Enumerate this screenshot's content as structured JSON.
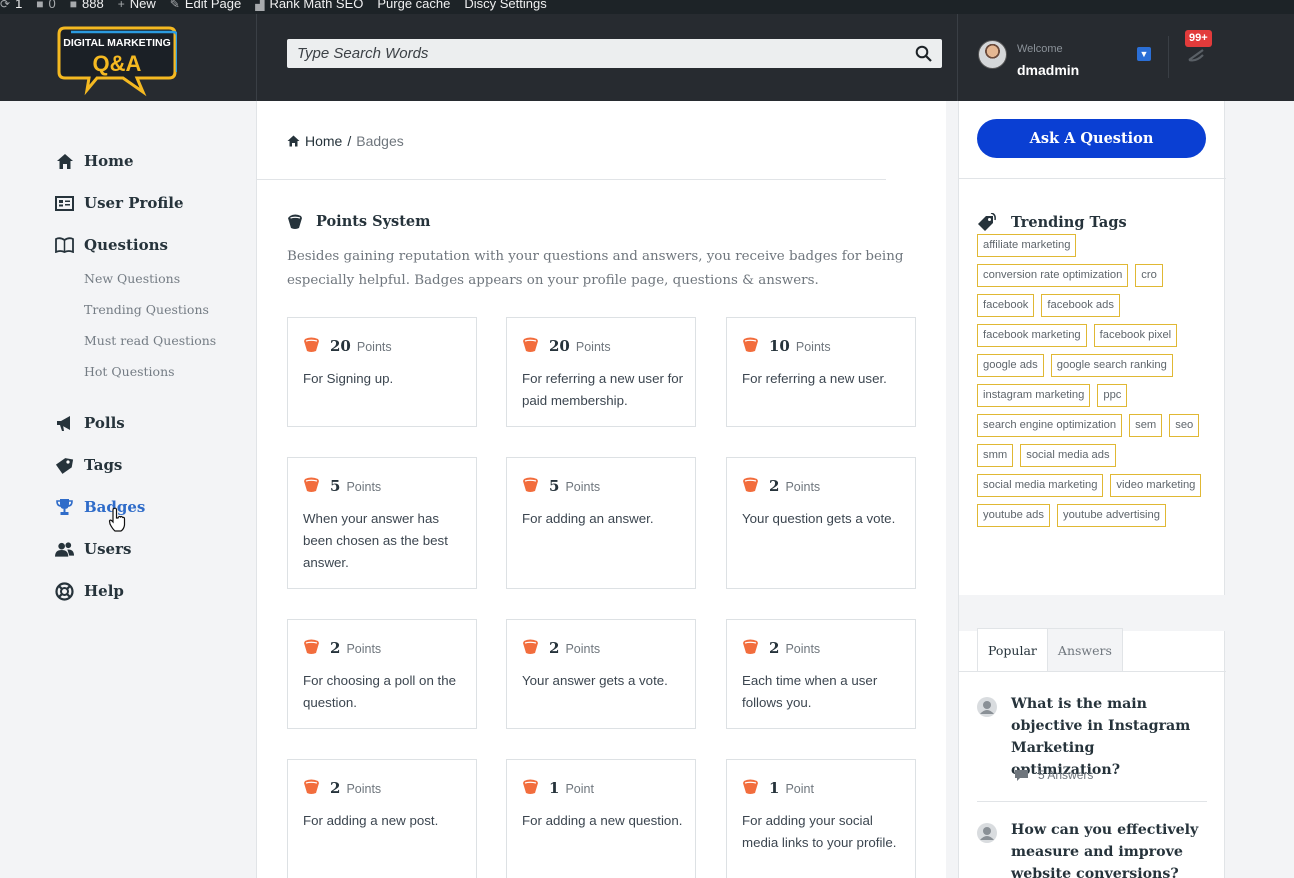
{
  "adminbar": {
    "updates": "1",
    "comments": "0",
    "count": "888",
    "new_label": "New",
    "edit_page": "Edit Page",
    "rank_math": "Rank Math SEO",
    "purge_cache": "Purge cache",
    "discy_settings": "Discy Settings"
  },
  "header": {
    "logo_line1": "DIGITAL MARKETING",
    "logo_line2": "Q&A",
    "search_placeholder": "Type Search Words",
    "welcome": "Welcome",
    "username": "dmadmin",
    "notif_count": "99+"
  },
  "nav": {
    "home": "Home",
    "user_profile": "User Profile",
    "questions": "Questions",
    "sub": [
      "New Questions",
      "Trending Questions",
      "Must read Questions",
      "Hot Questions"
    ],
    "polls": "Polls",
    "tags": "Tags",
    "badges": "Badges",
    "users": "Users",
    "help": "Help"
  },
  "breadcrumb": {
    "home": "Home",
    "sep": "/",
    "current": "Badges"
  },
  "points": {
    "title": "Points System",
    "intro": "Besides gaining reputation with your questions and answers, you receive badges for being especially helpful. Badges appears on your profile page, questions & answers.",
    "cards": [
      {
        "num": "20",
        "unit": "Points",
        "desc": "For Signing up."
      },
      {
        "num": "20",
        "unit": "Points",
        "desc": "For referring a new user for paid membership."
      },
      {
        "num": "10",
        "unit": "Points",
        "desc": "For referring a new user."
      },
      {
        "num": "5",
        "unit": "Points",
        "desc": "When your answer has been chosen as the best answer."
      },
      {
        "num": "5",
        "unit": "Points",
        "desc": "For adding an answer."
      },
      {
        "num": "2",
        "unit": "Points",
        "desc": "Your question gets a vote."
      },
      {
        "num": "2",
        "unit": "Points",
        "desc": "For choosing a poll on the question."
      },
      {
        "num": "2",
        "unit": "Points",
        "desc": "Your answer gets a vote."
      },
      {
        "num": "2",
        "unit": "Points",
        "desc": "Each time when a user follows you."
      },
      {
        "num": "2",
        "unit": "Points",
        "desc": "For adding a new post."
      },
      {
        "num": "1",
        "unit": "Point",
        "desc": "For adding a new question."
      },
      {
        "num": "1",
        "unit": "Point",
        "desc": "For adding your social media links to your profile."
      }
    ]
  },
  "sidebar": {
    "ask_button": "Ask A Question",
    "trending_title": "Trending Tags",
    "tags": [
      "affiliate marketing",
      "conversion rate optimization",
      "cro",
      "facebook",
      "facebook ads",
      "facebook marketing",
      "facebook pixel",
      "google ads",
      "google search ranking",
      "instagram marketing",
      "ppc",
      "search engine optimization",
      "sem",
      "seo",
      "smm",
      "social media ads",
      "social media marketing",
      "video marketing",
      "youtube ads",
      "youtube advertising"
    ],
    "tab_popular": "Popular",
    "tab_answers": "Answers",
    "questions": [
      {
        "title": "What is the main objective in Instagram Marketing optimization?",
        "answers": "5 Answers"
      },
      {
        "title": "How can you effectively measure and improve website conversions?",
        "answers": ""
      }
    ]
  },
  "colors": {
    "accent_blue": "#0a3fd3",
    "active_nav": "#2f6cc9",
    "badge_orange": "#f26d3d",
    "tag_border": "#e0b834",
    "header_bg": "#272b30"
  }
}
